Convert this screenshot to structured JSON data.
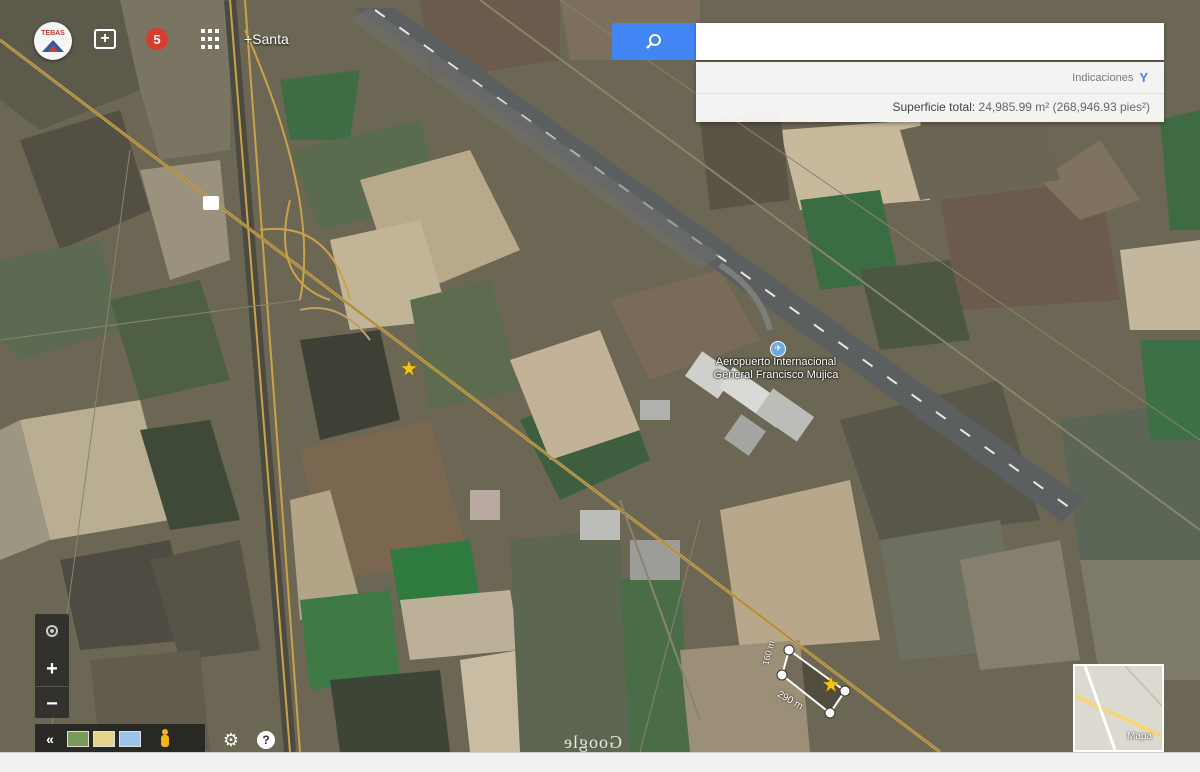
{
  "toolbar": {
    "logo_text": "TEBAS",
    "add_label": "+",
    "notification_count": "5",
    "user_link": "+Santa"
  },
  "search": {
    "value": "",
    "placeholder": "",
    "directions_label": "Indicaciones",
    "area_label": "Superficie total:",
    "area_value": "24,985.99 m² (268,946.93 pies²)"
  },
  "map": {
    "airport_line1": "Aeropuerto Internacional",
    "airport_line2": "General Francisco Mujica",
    "brand": "Google",
    "scale_label": "290 m",
    "scale_label_2": "160 m",
    "zoom_in": "+",
    "zoom_out": "−",
    "collapse_label": "«",
    "help_label": "?",
    "settings_label": "⚙",
    "mini_map_label": "Mapa",
    "colors": {
      "search_button": "#4285f4",
      "notification": "#d63c2f",
      "pegman": "#f2b418",
      "marker": "#f5c518"
    }
  }
}
